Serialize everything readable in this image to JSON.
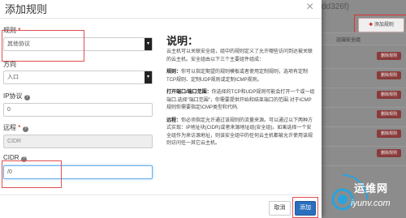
{
  "background": {
    "partial_title": "dd326f)",
    "add_rule_button": "添加规则",
    "table_header": [
      "远端安全组",
      ""
    ],
    "delete_labels": [
      "删除规则",
      "删除规则",
      "删除规则",
      "删除规则",
      "删除规则",
      "删除规则"
    ]
  },
  "modal": {
    "title": "添加规则",
    "close_glyph": "×",
    "fields": {
      "rule": {
        "label": "规则",
        "required": "*",
        "value": "其他协议"
      },
      "direction": {
        "label": "方向",
        "value": "入口"
      },
      "ip_protocol": {
        "label": "IP协议",
        "value": "0"
      },
      "remote": {
        "label": "远程",
        "required": "*",
        "value": "CIDR"
      },
      "cidr": {
        "label": "CIDR",
        "value": "/0"
      }
    },
    "description": {
      "title": "说明：",
      "intro": "云主机可以关联安全组，组中的规则定义了允许哪些访问到达被关联的云主机。安全组由以下三个主要组件组成：",
      "rule_label": "规则：",
      "rule_text": "你可以指定期望的规则模板或者使用定制规则，选项有定制TCP规则、定制UDP规则或定制ICMP规则。",
      "port_label": "打开端口/端口范围：",
      "port_text": "你选择的TCP和UDP规则可能会打开一个或一组端口.选择\"端口范围\"，你需要提供开始和结束端口的范围.对于ICMP规则你需要指定ICMP类型和代码.",
      "remote_label": "远程：",
      "remote_text": "你必须指定允许通过该规则的流量来源。可以通过以下两种方式实现：IP地址块(CIDR)或者来源地址组(安全组)。如果选择一个安全组作为来访源地址，则该安全组中的任何云主机都被允许使用该规则访问任一其它云主机。"
    },
    "buttons": {
      "cancel": "取消",
      "add": "添加"
    }
  },
  "watermark": {
    "line1": "运维网",
    "line2": "iyunv.com"
  },
  "colors": {
    "primary": "#2a6fbd",
    "highlight": "#e05050",
    "delete": "#8a3a3a"
  }
}
